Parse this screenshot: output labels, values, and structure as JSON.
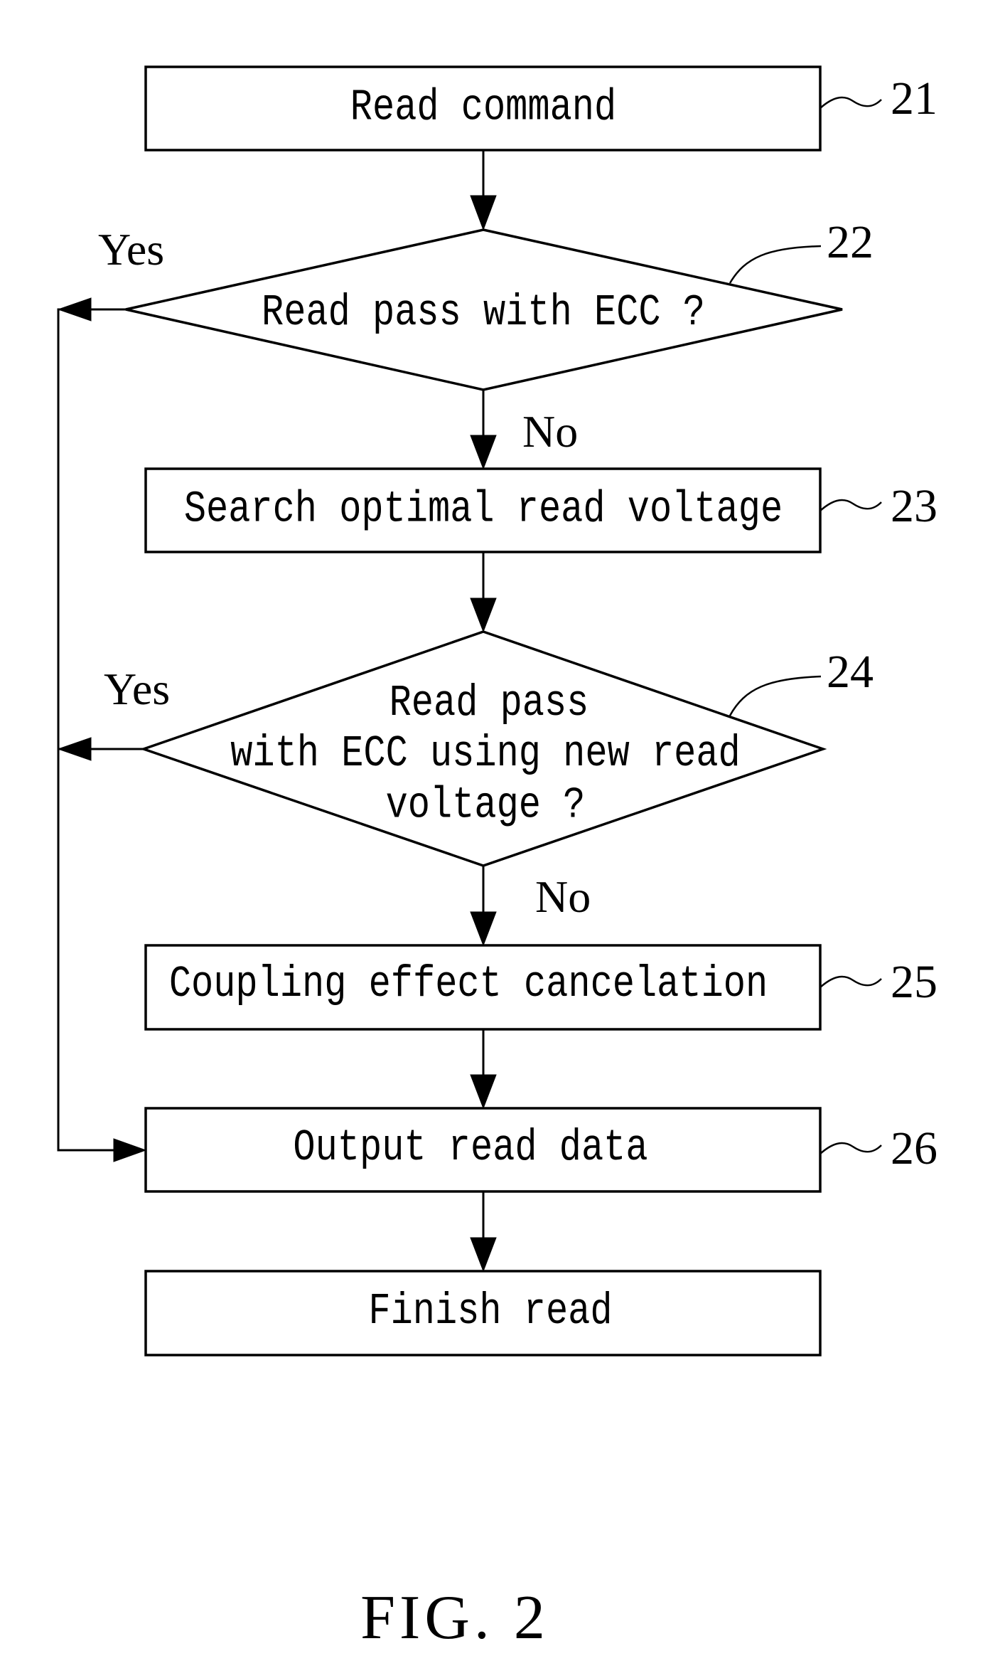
{
  "figure": {
    "caption": "FIG. 2",
    "steps": [
      {
        "id": "21",
        "type": "process",
        "text": [
          "Read command"
        ]
      },
      {
        "id": "22",
        "type": "decision",
        "text": [
          "Read pass with ECC ?"
        ],
        "yes_label": "Yes",
        "no_label": "No"
      },
      {
        "id": "23",
        "type": "process",
        "text": [
          "Search optimal read voltage"
        ]
      },
      {
        "id": "24",
        "type": "decision",
        "text": [
          "Read pass",
          "with ECC using new read",
          "voltage ?"
        ],
        "yes_label": "Yes",
        "no_label": "No"
      },
      {
        "id": "25",
        "type": "process",
        "text": [
          "Coupling effect cancelation"
        ]
      },
      {
        "id": "26",
        "type": "process",
        "text": [
          "Output read data"
        ]
      },
      {
        "id": "",
        "type": "process",
        "text": [
          "Finish read"
        ]
      }
    ],
    "edges": [
      {
        "from": "21",
        "to": "22"
      },
      {
        "from": "22",
        "to": "23",
        "label": "No"
      },
      {
        "from": "22",
        "to": "26",
        "label": "Yes"
      },
      {
        "from": "23",
        "to": "24"
      },
      {
        "from": "24",
        "to": "25",
        "label": "No"
      },
      {
        "from": "24",
        "to": "26",
        "label": "Yes"
      },
      {
        "from": "25",
        "to": "26"
      },
      {
        "from": "26",
        "to": "finish"
      }
    ]
  }
}
